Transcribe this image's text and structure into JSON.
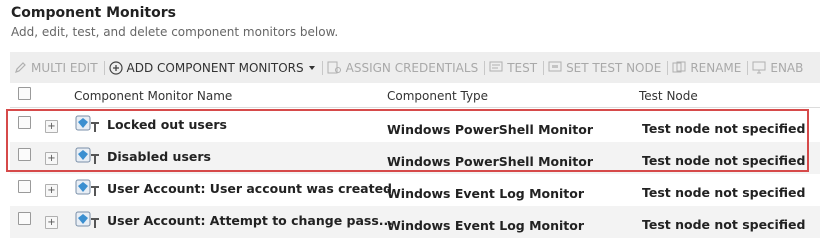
{
  "page": {
    "title": "Component Monitors",
    "subtitle": "Add, edit, test, and delete component monitors below."
  },
  "toolbar": {
    "multi_edit": "MULTI EDIT",
    "add_component_monitors": "ADD COMPONENT MONITORS",
    "assign_credentials": "ASSIGN CREDENTIALS",
    "test": "TEST",
    "set_test_node": "SET TEST NODE",
    "rename": "RENAME",
    "enable": "ENAB"
  },
  "table": {
    "columns": [
      "Component Monitor Name",
      "Component Type",
      "Test Node"
    ],
    "rows": [
      {
        "name": "Locked out users",
        "type": "Windows PowerShell Monitor",
        "test_node": "Test node not specified"
      },
      {
        "name": "Disabled users",
        "type": "Windows PowerShell Monitor",
        "test_node": "Test node not specified"
      },
      {
        "name": "User Account: User account was created",
        "type": "Windows Event Log Monitor",
        "test_node": "Test node not specified"
      },
      {
        "name": "User Account: Attempt to change pass...",
        "type": "Windows Event Log Monitor",
        "test_node": "Test node not specified"
      }
    ]
  },
  "colors": {
    "highlight": "#d64a4a",
    "toolbar_bg": "#eeeeee",
    "alt_row_bg": "#f3f3f3"
  }
}
